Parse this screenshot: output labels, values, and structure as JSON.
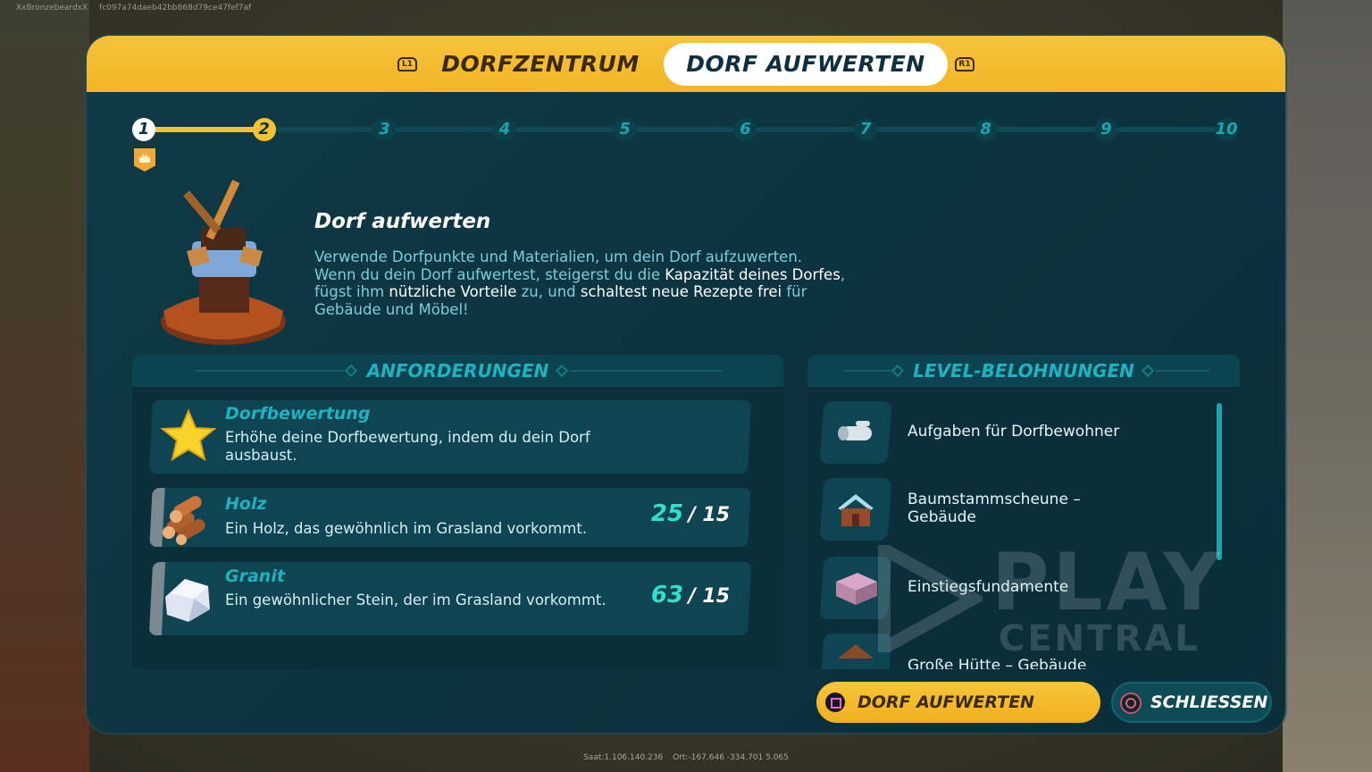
{
  "overlay": {
    "username": "XxBronzebeardxX",
    "session_id": "fc097a74daeb42bb868d79ce47fef7af",
    "seed": "Saat:1.106.140.236",
    "location": "Ort:-167.646  -334.701  5.065"
  },
  "header": {
    "left_button": "L1",
    "right_button": "R1",
    "tabs": [
      {
        "label": "DORFZENTRUM",
        "active": false
      },
      {
        "label": "DORF AUFWERTEN",
        "active": true
      }
    ]
  },
  "progress": {
    "current_level": 1,
    "next_level": 2,
    "steps": [
      "1",
      "2",
      "3",
      "4",
      "5",
      "6",
      "7",
      "8",
      "9",
      "10"
    ],
    "fill_fraction": 0.111
  },
  "intro": {
    "title": "Dorf aufwerten",
    "line1": "Verwende Dorfpunkte und Materialien, um dein Dorf aufzuwerten.",
    "line2a": "Wenn du dein Dorf aufwertest, steigerst du die ",
    "line2b": "Kapazität deines Dorfes",
    "line2c": ",",
    "line3a": "fügst ihm ",
    "line3b": "nützliche Vorteile",
    "line3c": " zu, und ",
    "line3d": "schaltest neue Rezepte frei",
    "line3e": " für",
    "line4": "Gebäude und Möbel!"
  },
  "requirements": {
    "heading": "ANFORDERUNGEN",
    "items": [
      {
        "name": "Dorfbewertung",
        "text": "Erhöhe deine Dorfbewertung, indem du dein Dorf ausbaust.",
        "icon": "star-icon"
      },
      {
        "name": "Holz",
        "text": "Ein Holz, das gewöhnlich im Grasland vorkommt.",
        "have": "25",
        "sep": "/ 15",
        "icon": "wood-logs-icon"
      },
      {
        "name": "Granit",
        "text": "Ein gewöhnlicher Stein, der im Grasland vorkommt.",
        "have": "63",
        "sep": "/ 15",
        "icon": "granite-icon"
      }
    ]
  },
  "rewards": {
    "heading": "LEVEL-BELOHNUNGEN",
    "items": [
      {
        "label": "Aufgaben für Dorfbewohner",
        "icon": "task-log-icon"
      },
      {
        "label": "Baumstammscheune – Gebäude",
        "icon": "barn-icon"
      },
      {
        "label": "Einstiegsfundamente",
        "icon": "foundation-icon"
      },
      {
        "label": "Große Hütte – Gebäude",
        "icon": "hut-icon"
      }
    ]
  },
  "actions": {
    "upgrade_label": "DORF AUFWERTEN",
    "close_label": "SCHLIESSEN"
  },
  "watermark": {
    "line1": "PLAY",
    "line2": "CENTRAL"
  },
  "colors": {
    "accent": "#f4c230",
    "teal": "#1fb3bf",
    "panel": "#0c3340"
  }
}
